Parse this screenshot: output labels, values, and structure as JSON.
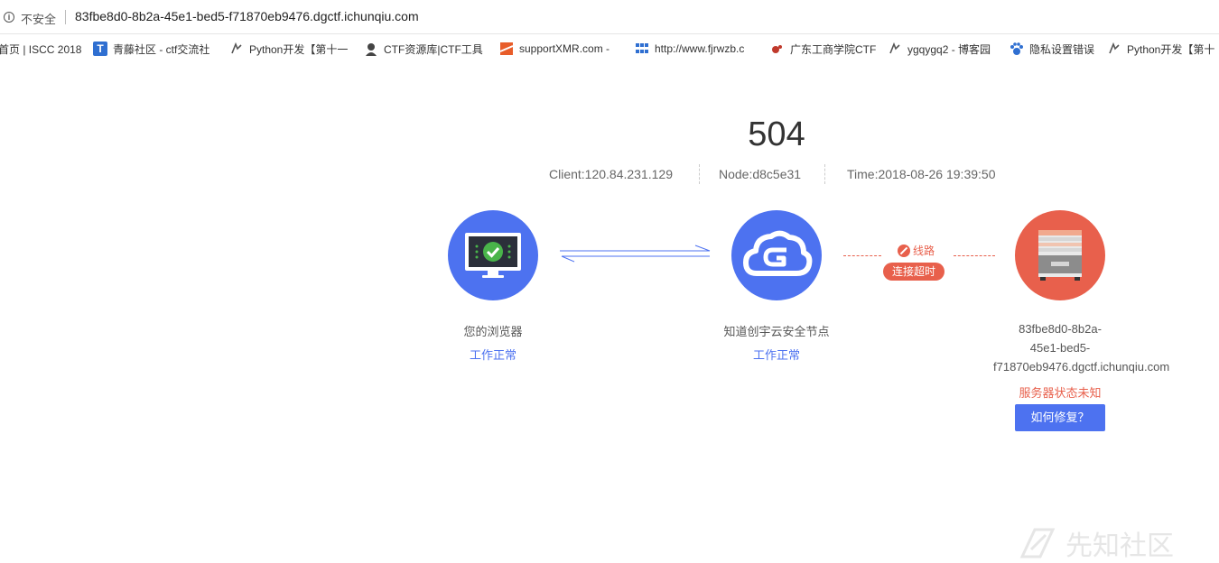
{
  "browser": {
    "security_label": "不安全",
    "url": "83fbe8d0-8b2a-45e1-bed5-f71870eb9476.dgctf.ichunqiu.com"
  },
  "bookmarks": [
    {
      "label": "首页 | ISCC 2018",
      "icon": "none",
      "color": ""
    },
    {
      "label": "青藤社区 - ctf交流社",
      "icon": "t-square-icon",
      "color": "#2f6fd1"
    },
    {
      "label": "Python开发【第十一",
      "icon": "cnblogs-icon",
      "color": "#555555"
    },
    {
      "label": "CTF资源库|CTF工具",
      "icon": "hacker-icon",
      "color": "#444444"
    },
    {
      "label": "supportXMR.com -",
      "icon": "xmr-icon",
      "color": "#e85d2a"
    },
    {
      "label": "http://www.fjrwzb.c",
      "icon": "grid-icon",
      "color": "#2f6fd1"
    },
    {
      "label": "广东工商学院CTF",
      "icon": "red-dot-icon",
      "color": "#c0392b"
    },
    {
      "label": "ygqygq2 - 博客园",
      "icon": "cnblogs-icon",
      "color": "#555555"
    },
    {
      "label": "隐私设置错误",
      "icon": "paw-icon",
      "color": "#2f6fd1"
    },
    {
      "label": "Python开发【第十",
      "icon": "cnblogs-icon",
      "color": "#555555"
    }
  ],
  "error": {
    "code": "504",
    "client": "Client:120.84.231.129",
    "node": "Node:d8c5e31",
    "time": "Time:2018-08-26 19:39:50"
  },
  "nodes": {
    "browser": {
      "label": "您的浏览器",
      "status": "工作正常"
    },
    "cdn": {
      "label": "知道创宇云安全节点",
      "status": "工作正常"
    },
    "server": {
      "host_line1": "83fbe8d0-8b2a-",
      "host_line2": "45e1-bed5-",
      "host_line3": "f71870eb9476.dgctf.ichunqiu.com",
      "status": "服务器状态未知",
      "fix_label": "如何修复？"
    }
  },
  "link": {
    "route_label": "线路",
    "timeout_label": "连接超时"
  },
  "watermark": {
    "text": "先知社区"
  },
  "colors": {
    "blue": "#4d72f0",
    "red": "#e8604c"
  }
}
